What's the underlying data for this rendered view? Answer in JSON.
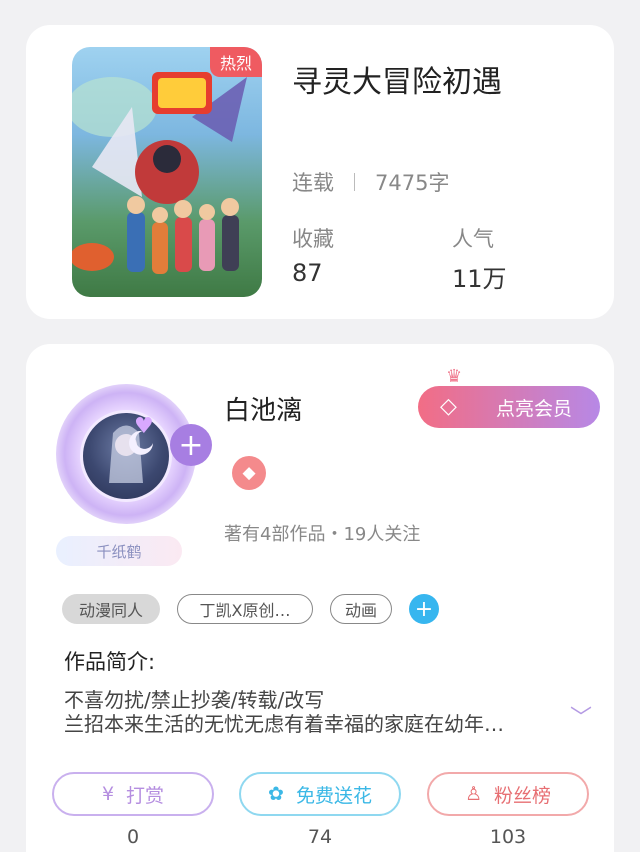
{
  "book": {
    "hot_label": "热烈",
    "title": "寻灵大冒险初遇",
    "status": "连载",
    "word_count": "7475字",
    "stats": [
      {
        "label": "收藏",
        "value": "87"
      },
      {
        "label": "人气",
        "value": "11万"
      }
    ]
  },
  "author": {
    "badge": "千纸鹤",
    "name": "白池漓",
    "vip_button": "点亮会员",
    "works_info": "著有4部作品・19人关注"
  },
  "tags": [
    "动漫同人",
    "丁凯X原创…",
    "动画"
  ],
  "intro": {
    "title": "作品简介:",
    "lines": [
      "不喜勿扰/禁止抄袭/转载/改写",
      "兰招本来生活的无忧无虑有着幸福的家庭在幼年…"
    ]
  },
  "actions": [
    {
      "label": "打赏",
      "icon": "yen-icon",
      "count": "0",
      "color": "#b58ee0"
    },
    {
      "label": "免费送花",
      "icon": "flower-icon",
      "count": "74",
      "color": "#3bb8e6"
    },
    {
      "label": "粉丝榜",
      "icon": "fans-icon",
      "count": "103",
      "color": "#e76f73"
    }
  ]
}
